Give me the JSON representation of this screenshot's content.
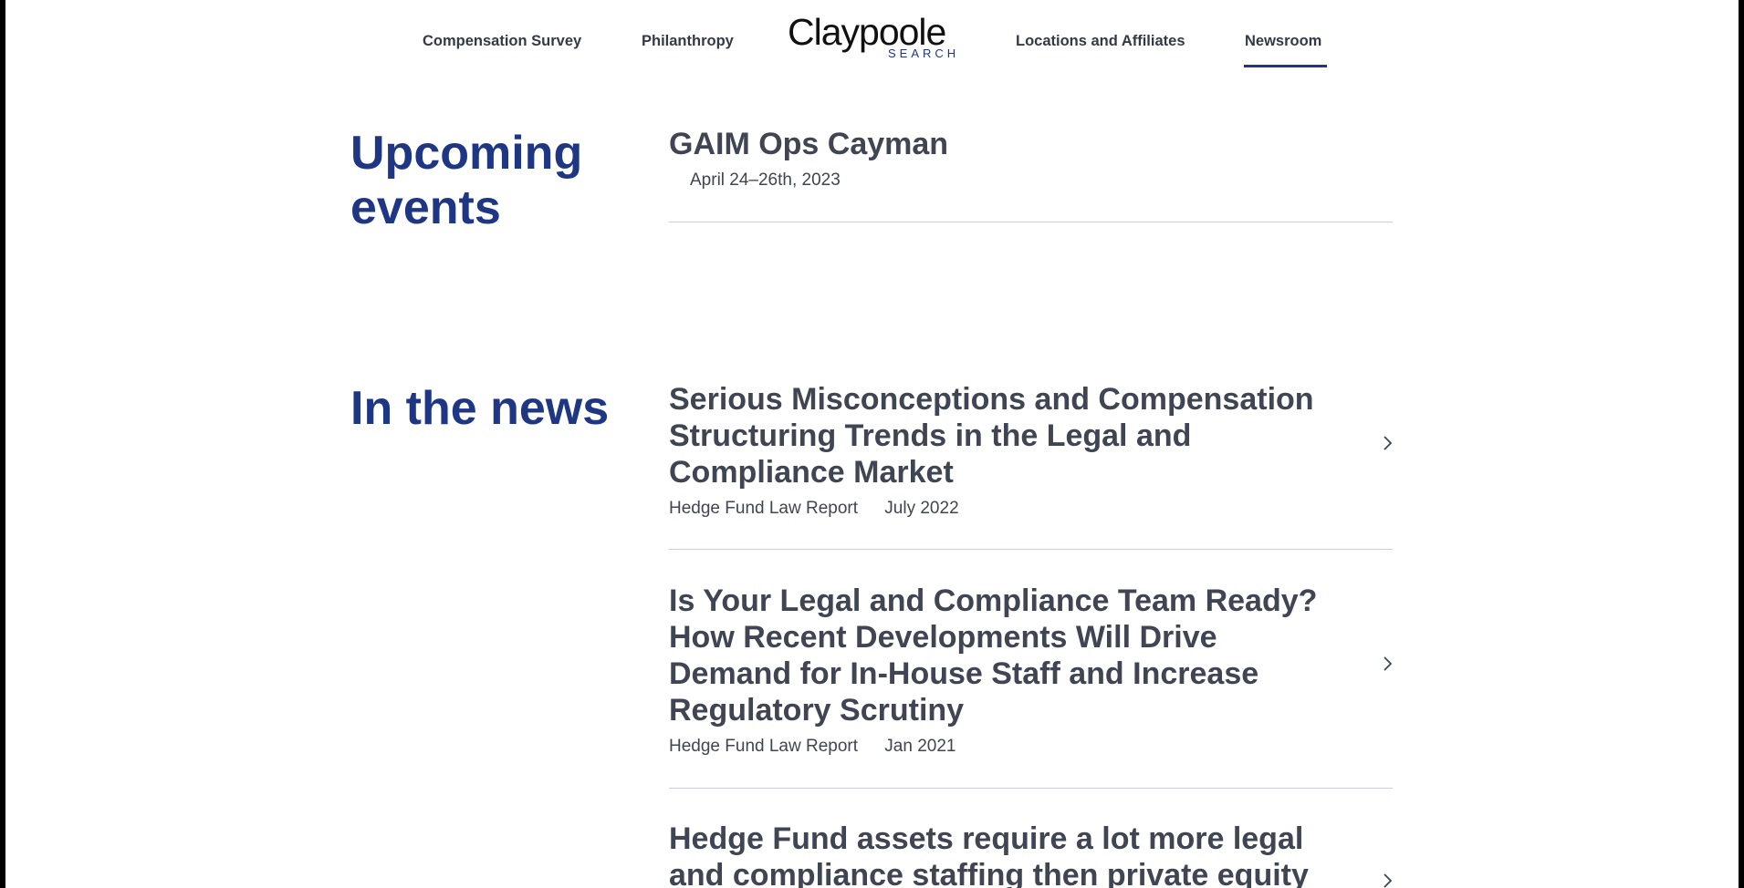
{
  "nav": {
    "left_links": [
      "Compensation Survey",
      "Philanthropy"
    ],
    "right_links": [
      "Locations and Affiliates",
      "Newsroom"
    ],
    "active": "Newsroom"
  },
  "logo": {
    "word": "Claypoole",
    "sub": "SEARCH"
  },
  "events": {
    "heading": "Upcoming events",
    "items": [
      {
        "title": "GAIM Ops Cayman",
        "date": "April 24–26th, 2023"
      }
    ]
  },
  "news": {
    "heading": "In the news",
    "items": [
      {
        "title": "Serious Misconceptions and Compensation Structuring Trends in the Legal and Compliance Market",
        "source": "Hedge Fund Law Report",
        "date": "July 2022"
      },
      {
        "title": "Is Your Legal and Compliance Team Ready? How Recent Developments Will Drive Demand for In-House Staff and Increase Regulatory Scrutiny",
        "source": "Hedge Fund Law Report",
        "date": "Jan 2021"
      },
      {
        "title": "Hedge Fund assets require a lot more legal and compliance staffing then private equity",
        "source": "",
        "date": ""
      }
    ]
  },
  "colors": {
    "brand": "#1f3684",
    "text": "#3f4552",
    "divider": "#c9cedd"
  }
}
